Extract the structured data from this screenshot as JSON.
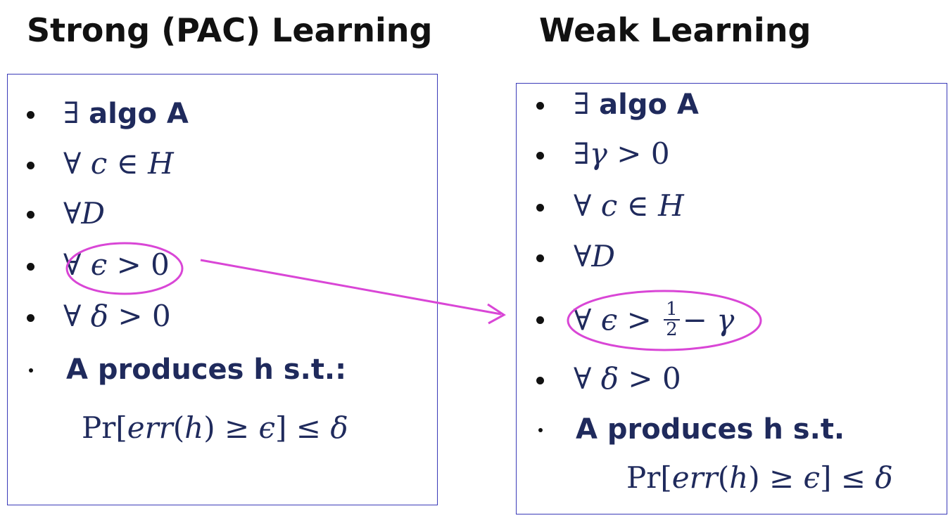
{
  "left": {
    "heading": "Strong (PAC) Learning",
    "items": [
      {
        "symbol": "∃",
        "rest": "algo A"
      },
      {
        "symbol": "∀",
        "var": "c",
        "rel": "∈",
        "set": "H"
      },
      {
        "symbol": "∀",
        "var": "D"
      },
      {
        "symbol": "∀",
        "var": "ϵ",
        "rel": ">",
        "value": "0"
      },
      {
        "symbol": "∀",
        "var": "δ",
        "rel": ">",
        "value": "0"
      },
      {
        "text": "A produces h s.t.:"
      }
    ],
    "formula": {
      "pr": "Pr",
      "err": "err",
      "h": "h",
      "geq": "≥",
      "eps": "ϵ",
      "leq": "≤",
      "delta": "δ"
    }
  },
  "right": {
    "heading": "Weak Learning",
    "items": [
      {
        "symbol": "∃",
        "rest": "algo A"
      },
      {
        "symbol": "∃",
        "var": "γ",
        "rel": ">",
        "value": "0"
      },
      {
        "symbol": "∀",
        "var": "c",
        "rel": "∈",
        "set": "H"
      },
      {
        "symbol": "∀",
        "var": "D"
      },
      {
        "symbol": "∀",
        "var": "ϵ",
        "rel": ">",
        "num": "1",
        "den": "2",
        "minus": "−",
        "gamma": "γ"
      },
      {
        "symbol": "∀",
        "var": "δ",
        "rel": ">",
        "value": "0"
      },
      {
        "text": "A produces h s.t."
      }
    ],
    "formula": {
      "pr": "Pr",
      "err": "err",
      "h": "h",
      "geq": "≥",
      "eps": "ϵ",
      "leq": "≤",
      "delta": "δ"
    }
  },
  "annotation_color": "#d946d6",
  "border_color": "#3a3ab8",
  "text_color": "#1f2a5c"
}
